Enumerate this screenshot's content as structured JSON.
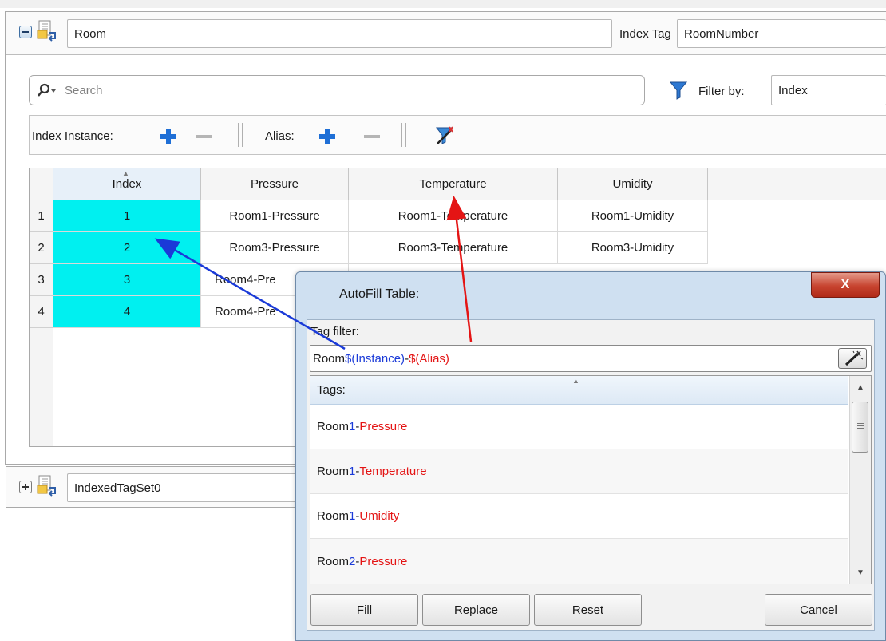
{
  "header": {
    "set_name": "Room",
    "index_tag_label": "Index Tag",
    "index_tag_value": "RoomNumber"
  },
  "search": {
    "placeholder": "Search",
    "filter_label": "Filter by:",
    "filter_value": "Index"
  },
  "toolbar": {
    "index_instance_label": "Index Instance:",
    "alias_label": "Alias:"
  },
  "grid": {
    "columns": [
      "Index",
      "Pressure",
      "Temperature",
      "Umidity"
    ],
    "rows": [
      {
        "num": "1",
        "index": "1",
        "pressure": "Room1-Pressure",
        "temperature": "Room1-Temperature",
        "umidity": "Room1-Umidity"
      },
      {
        "num": "2",
        "index": "2",
        "pressure": "Room3-Pressure",
        "temperature": "Room3-Temperature",
        "umidity": "Room3-Umidity"
      },
      {
        "num": "3",
        "index": "3",
        "pressure": "Room4-Pre"
      },
      {
        "num": "4",
        "index": "4",
        "pressure": "Room4-Pre"
      }
    ]
  },
  "second_set": {
    "name": "IndexedTagSet0"
  },
  "dialog": {
    "title": "AutoFill Table:",
    "close_label": "X",
    "tag_filter_label": "Tag filter:",
    "filter": {
      "prefix": "Room",
      "instance": "$(Instance)",
      "dash": "-",
      "alias": "$(Alias)"
    },
    "tags_header": "Tags:",
    "tags": [
      {
        "prefix": "Room",
        "num": "1",
        "dash": "-",
        "alias": "Pressure"
      },
      {
        "prefix": "Room",
        "num": "1",
        "dash": "-",
        "alias": "Temperature"
      },
      {
        "prefix": "Room",
        "num": "1",
        "dash": "-",
        "alias": "Umidity"
      },
      {
        "prefix": "Room",
        "num": "2",
        "dash": "-",
        "alias": "Pressure"
      }
    ],
    "buttons": {
      "fill": "Fill",
      "replace": "Replace",
      "reset": "Reset",
      "cancel": "Cancel"
    }
  },
  "colors": {
    "accent_blue": "#1a3ad8",
    "accent_red": "#e41414",
    "cyan": "#00f0f0"
  }
}
